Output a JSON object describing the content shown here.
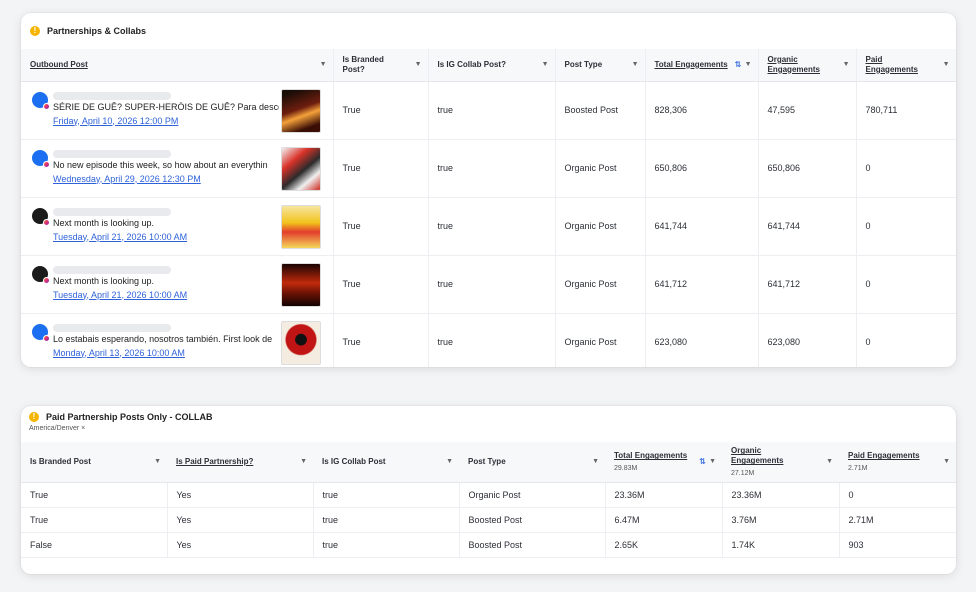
{
  "card1": {
    "title": "Partnerships & Collabs",
    "columns": [
      "Outbound Post",
      "Is Branded Post?",
      "Is IG Collab Post?",
      "Post Type",
      "Total Engagements",
      "Organic Engagements",
      "Paid Engagements"
    ],
    "rows": [
      {
        "text": "SÉRIE DE GUÊ? SUPER-HERÓIS DE GUÊ? Para descob",
        "date": "Friday, April 10, 2026 12:00 PM",
        "branded": "True",
        "collab": "true",
        "type": "Boosted Post",
        "total": "828,306",
        "organic": "47,595",
        "paid": "780,711"
      },
      {
        "text": "No new episode this week, so how about an everythin",
        "date": "Wednesday, April 29, 2026 12:30 PM",
        "branded": "True",
        "collab": "true",
        "type": "Organic Post",
        "total": "650,806",
        "organic": "650,806",
        "paid": "0"
      },
      {
        "text": "Next month is looking up.",
        "date": "Tuesday, April 21, 2026 10:00 AM",
        "branded": "True",
        "collab": "true",
        "type": "Organic Post",
        "total": "641,744",
        "organic": "641,744",
        "paid": "0"
      },
      {
        "text": "Next month is looking up.",
        "date": "Tuesday, April 21, 2026 10:00 AM",
        "branded": "True",
        "collab": "true",
        "type": "Organic Post",
        "total": "641,712",
        "organic": "641,712",
        "paid": "0"
      },
      {
        "text": "Lo estabais esperando, nosotros también. First look de",
        "date": "Monday, April 13, 2026 10:00 AM",
        "branded": "True",
        "collab": "true",
        "type": "Organic Post",
        "total": "623,080",
        "organic": "623,080",
        "paid": "0"
      }
    ]
  },
  "card2": {
    "title": "Paid Partnership Posts Only - COLLAB",
    "timezone": "America/Denver ×",
    "columns": [
      "Is Branded Post",
      "Is Paid Partnership?",
      "Is IG Collab Post",
      "Post Type",
      "Total Engagements",
      "Organic Engagements",
      "Paid Engagements"
    ],
    "totals": {
      "total": "29.83M",
      "organic": "27.12M",
      "paid": "2.71M"
    },
    "rows": [
      {
        "branded": "True",
        "paid_partnership": "Yes",
        "collab": "true",
        "type": "Organic Post",
        "total": "23.36M",
        "organic": "23.36M",
        "paid": "0"
      },
      {
        "branded": "True",
        "paid_partnership": "Yes",
        "collab": "true",
        "type": "Boosted Post",
        "total": "6.47M",
        "organic": "3.76M",
        "paid": "2.71M"
      },
      {
        "branded": "False",
        "paid_partnership": "Yes",
        "collab": "true",
        "type": "Boosted Post",
        "total": "2.65K",
        "organic": "1.74K",
        "paid": "903"
      }
    ]
  },
  "icons": {
    "warning": "warning-icon",
    "caret": "chevron-down-icon",
    "sort": "sort-icon"
  },
  "colors": {
    "link": "#2e62d9",
    "warning": "#f5b400",
    "header_bg": "#f7f8fa"
  }
}
